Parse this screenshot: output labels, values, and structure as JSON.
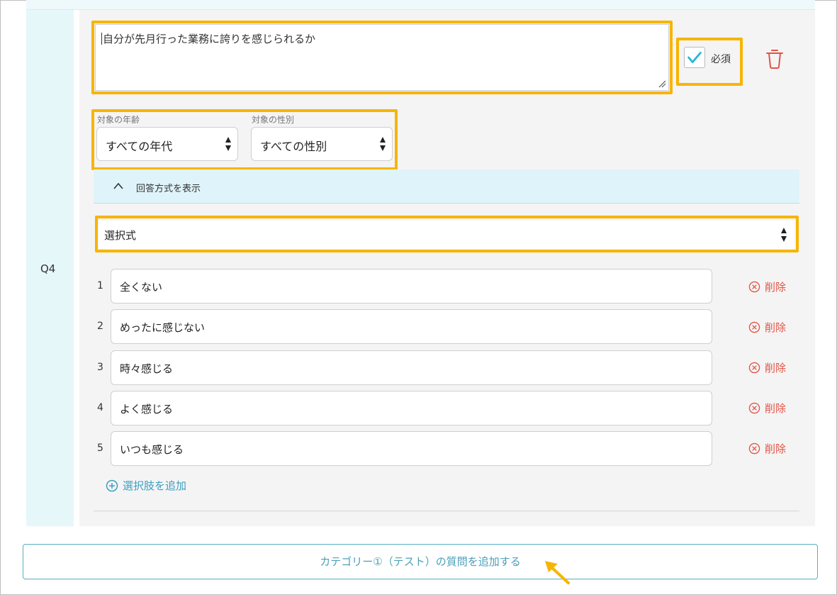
{
  "question": {
    "number": "Q4",
    "text": "自分が先月行った業務に誇りを感じられるか",
    "required_label": "必須",
    "required_checked": true
  },
  "filters": {
    "age": {
      "label": "対象の年齢",
      "value": "すべての年代"
    },
    "gender": {
      "label": "対象の性別",
      "value": "すべての性別"
    }
  },
  "answer_section": {
    "toggle_label": "回答方式を表示",
    "type_value": "選択式"
  },
  "choices": [
    {
      "num": "1",
      "value": "全くない",
      "delete_label": "削除"
    },
    {
      "num": "2",
      "value": "めったに感じない",
      "delete_label": "削除"
    },
    {
      "num": "3",
      "value": "時々感じる",
      "delete_label": "削除"
    },
    {
      "num": "4",
      "value": "よく感じる",
      "delete_label": "削除"
    },
    {
      "num": "5",
      "value": "いつも感じる",
      "delete_label": "削除"
    }
  ],
  "add_choice_label": "選択肢を追加",
  "add_question_label": "カテゴリー①（テスト）の質問を追加する",
  "colors": {
    "highlight": "#f7b500",
    "accent": "#3a9fbf",
    "danger": "#e05545",
    "check": "#29b6d8"
  }
}
